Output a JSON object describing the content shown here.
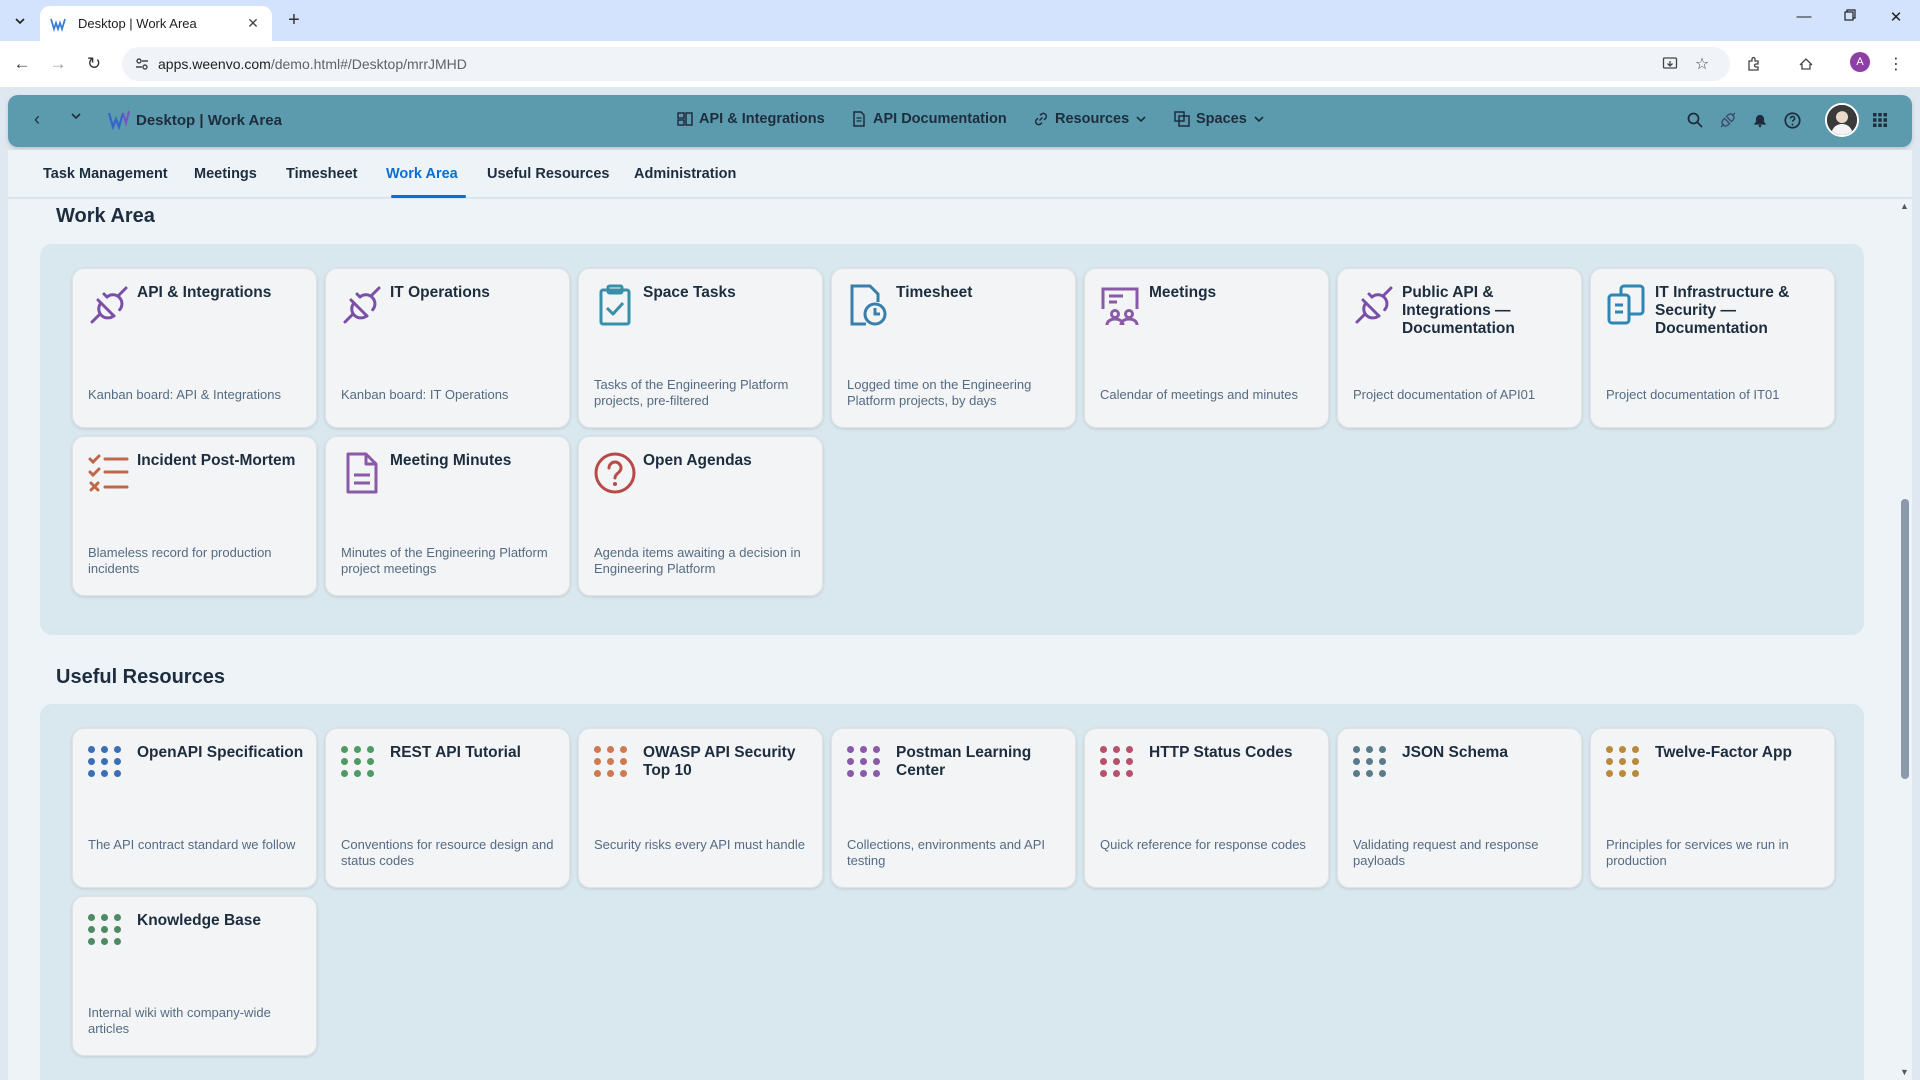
{
  "browser": {
    "tab_title": "Desktop | Work Area",
    "url_host": "apps.weenvo.com",
    "url_path": "/demo.html#/Desktop/mrrJMHD",
    "profile_initial": "A"
  },
  "shellbar": {
    "title": "Desktop | Work Area",
    "menu": [
      {
        "label": "API & Integrations"
      },
      {
        "label": "API Documentation"
      },
      {
        "label": "Resources"
      },
      {
        "label": "Spaces"
      }
    ]
  },
  "subnav": {
    "tabs": [
      "Task Management",
      "Meetings",
      "Timesheet",
      "Work Area",
      "Useful Resources",
      "Administration"
    ],
    "active": "Work Area"
  },
  "work_area": {
    "title": "Work Area",
    "cards": [
      {
        "title": "API & Integrations",
        "desc": "Kanban board: API & Integrations",
        "icon": "plug-icon",
        "color": "#7b4fa8"
      },
      {
        "title": "IT Operations",
        "desc": "Kanban board: IT Operations",
        "icon": "plug-icon",
        "color": "#7b4fa8"
      },
      {
        "title": "Space Tasks",
        "desc": "Tasks of the Engineering Platform projects, pre-filtered",
        "icon": "clipboard-check-icon",
        "color": "#3a8fa8"
      },
      {
        "title": "Timesheet",
        "desc": "Logged time on the Engineering Platform projects, by days",
        "icon": "document-clock-icon",
        "color": "#3a7fa8"
      },
      {
        "title": "Meetings",
        "desc": "Calendar of meetings and minutes",
        "icon": "meeting-board-icon",
        "color": "#8a5aa8"
      },
      {
        "title": "Public API & Integrations — Documentation",
        "desc": "Project documentation of API01",
        "icon": "plug-icon",
        "color": "#7b4fa8"
      },
      {
        "title": "IT Infrastructure & Security — Documentation",
        "desc": "Project documentation of IT01",
        "icon": "documents-icon",
        "color": "#2f86b5"
      },
      {
        "title": "Incident Post-Mortem",
        "desc": "Blameless record for production incidents",
        "icon": "checklist-icon",
        "color": "#c0674a"
      },
      {
        "title": "Meeting Minutes",
        "desc": "Minutes of the Engineering Platform project meetings",
        "icon": "document-icon",
        "color": "#8a5aa8"
      },
      {
        "title": "Open Agendas",
        "desc": "Agenda items awaiting a decision in Engineering Platform",
        "icon": "question-mark-icon",
        "color": "#b84a4a"
      }
    ]
  },
  "useful_resources": {
    "title": "Useful Resources",
    "cards": [
      {
        "title": "OpenAPI Specification",
        "desc": "The API contract standard we follow",
        "icon": "dots-grid-icon",
        "color": "#3b6fb5"
      },
      {
        "title": "REST API Tutorial",
        "desc": "Conventions for resource design and status codes",
        "icon": "dots-grid-icon",
        "color": "#4e9a64"
      },
      {
        "title": "OWASP API Security Top 10",
        "desc": "Security risks every API must handle",
        "icon": "dots-grid-icon",
        "color": "#d07a52"
      },
      {
        "title": "Postman Learning Center",
        "desc": "Collections, environments and API testing",
        "icon": "dots-grid-icon",
        "color": "#8a5aa8"
      },
      {
        "title": "HTTP Status Codes",
        "desc": "Quick reference for response codes",
        "icon": "dots-grid-icon",
        "color": "#b8506a"
      },
      {
        "title": "JSON Schema",
        "desc": "Validating request and response payloads",
        "icon": "dots-grid-icon",
        "color": "#5a7a8c"
      },
      {
        "title": "Twelve-Factor App",
        "desc": "Principles for services we run in production",
        "icon": "dots-grid-icon",
        "color": "#b88a3a"
      },
      {
        "title": "Knowledge Base",
        "desc": "Internal wiki with company-wide articles",
        "icon": "dots-grid-icon",
        "color": "#4e8a64"
      }
    ]
  }
}
